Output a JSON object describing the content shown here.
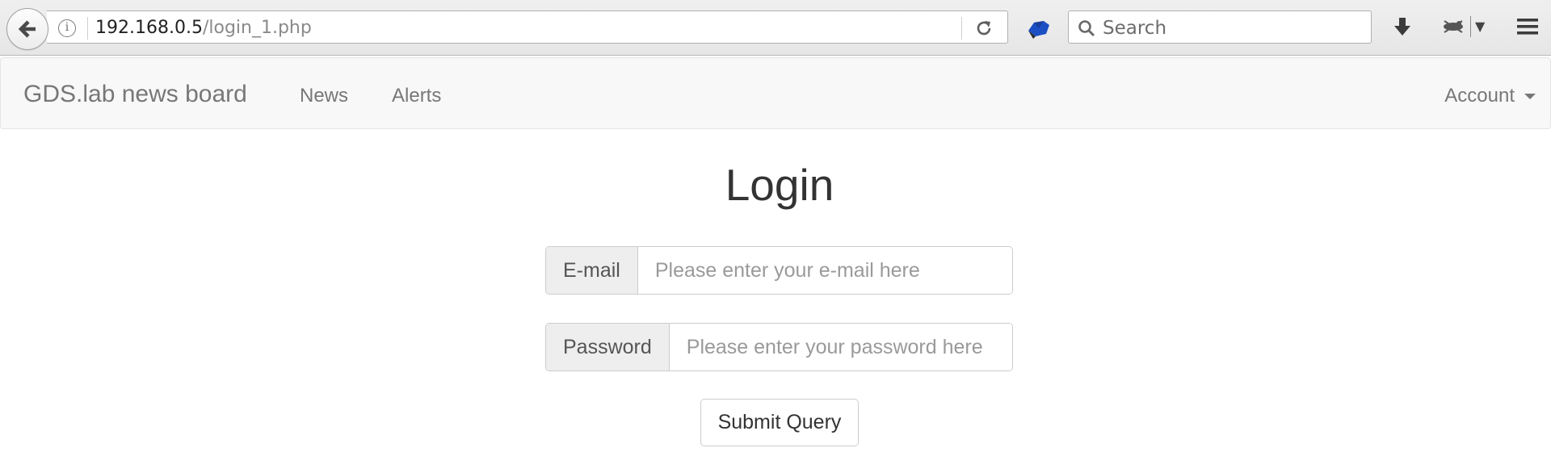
{
  "browser": {
    "url_host": "192.168.0.5",
    "url_path": "/login_1.php",
    "search_placeholder": "Search"
  },
  "navbar": {
    "brand": "GDS.lab news board",
    "links": [
      "News",
      "Alerts"
    ],
    "account_label": "Account"
  },
  "login": {
    "title": "Login",
    "email_label": "E-mail",
    "email_placeholder": "Please enter your e-mail here",
    "password_label": "Password",
    "password_placeholder": "Please enter your password here",
    "submit_label": "Submit Query"
  }
}
